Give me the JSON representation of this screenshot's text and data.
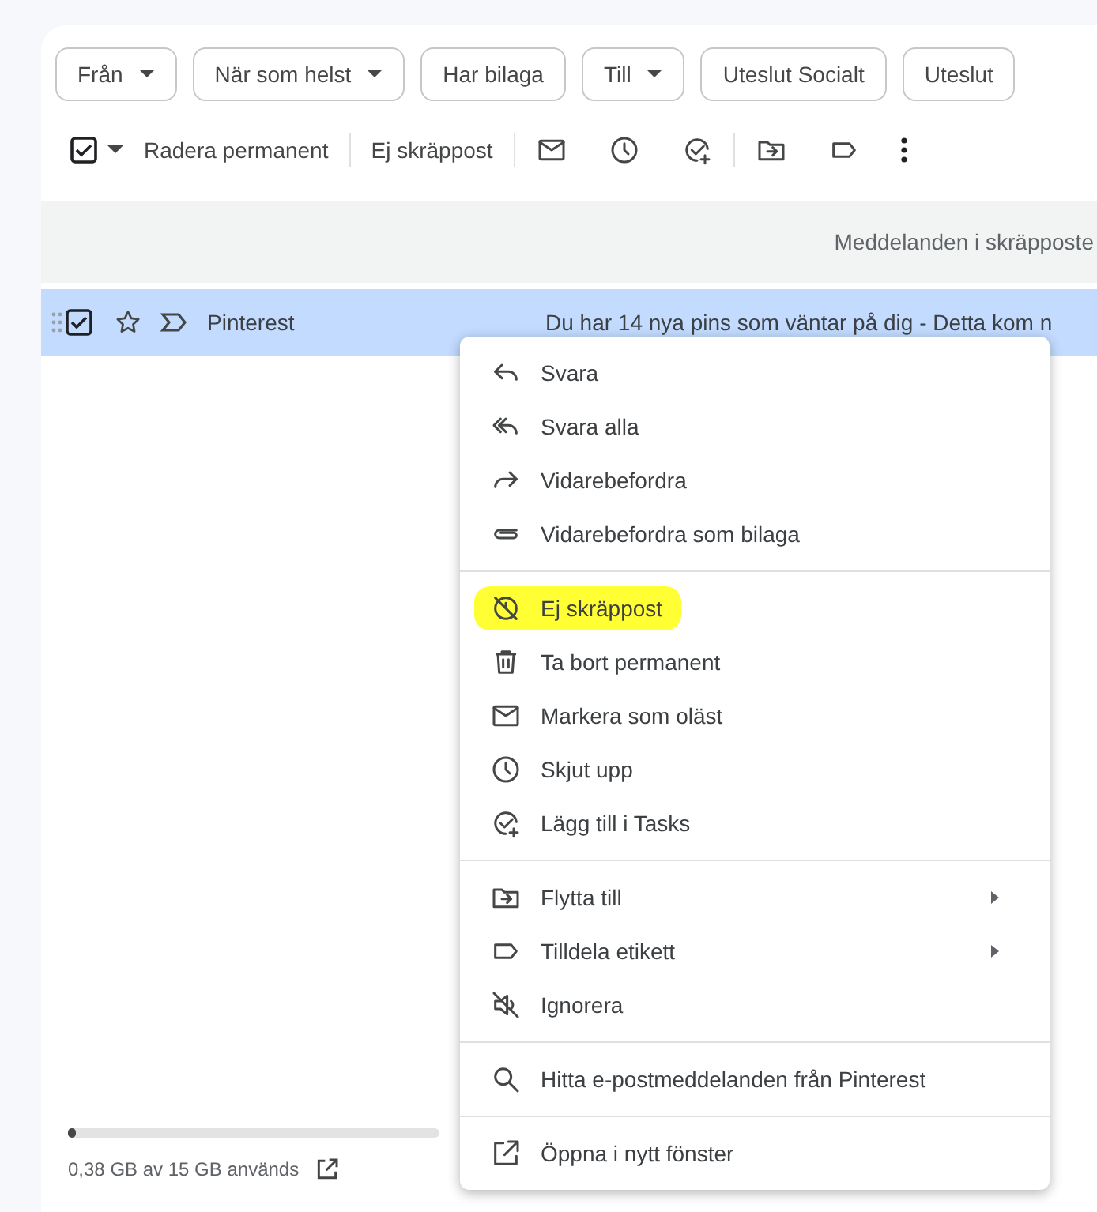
{
  "filter_chips": [
    {
      "label": "Från",
      "dropdown": true
    },
    {
      "label": "När som helst",
      "dropdown": true
    },
    {
      "label": "Har bilaga",
      "dropdown": false
    },
    {
      "label": "Till",
      "dropdown": true
    },
    {
      "label": "Uteslut Socialt",
      "dropdown": false
    },
    {
      "label": "Uteslut",
      "dropdown": false
    }
  ],
  "toolbar": {
    "select_all_checked": true,
    "actions": [
      "Radera permanent",
      "Ej skräppost"
    ]
  },
  "banner": "Meddelanden i skräpposte",
  "messages": [
    {
      "sender": "Pinterest",
      "snippet": "Du har 14 nya pins som väntar på dig - Detta kom n",
      "selected": true,
      "checked": true,
      "starred": false
    }
  ],
  "context_menu": [
    [
      {
        "label": "Svara",
        "highlighted": false,
        "submenu": false
      },
      {
        "label": "Svara alla",
        "highlighted": false,
        "submenu": false
      },
      {
        "label": "Vidarebefordra",
        "highlighted": false,
        "submenu": false
      },
      {
        "label": "Vidarebefordra som bilaga",
        "highlighted": false,
        "submenu": false
      }
    ],
    [
      {
        "label": "Ej skräppost",
        "highlighted": true,
        "submenu": false
      },
      {
        "label": "Ta bort permanent",
        "highlighted": false,
        "submenu": false
      },
      {
        "label": "Markera som oläst",
        "highlighted": false,
        "submenu": false
      },
      {
        "label": "Skjut upp",
        "highlighted": false,
        "submenu": false
      },
      {
        "label": "Lägg till i Tasks",
        "highlighted": false,
        "submenu": false
      }
    ],
    [
      {
        "label": "Flytta till",
        "highlighted": false,
        "submenu": true
      },
      {
        "label": "Tilldela etikett",
        "highlighted": false,
        "submenu": true
      },
      {
        "label": "Ignorera",
        "highlighted": false,
        "submenu": false
      }
    ],
    [
      {
        "label": "Hitta e-postmeddelanden från Pinterest",
        "highlighted": false,
        "submenu": false
      }
    ],
    [
      {
        "label": "Öppna i nytt fönster",
        "highlighted": false,
        "submenu": false
      }
    ]
  ],
  "storage": {
    "level": 0.02,
    "text": "0,38 GB av 15 GB används"
  }
}
